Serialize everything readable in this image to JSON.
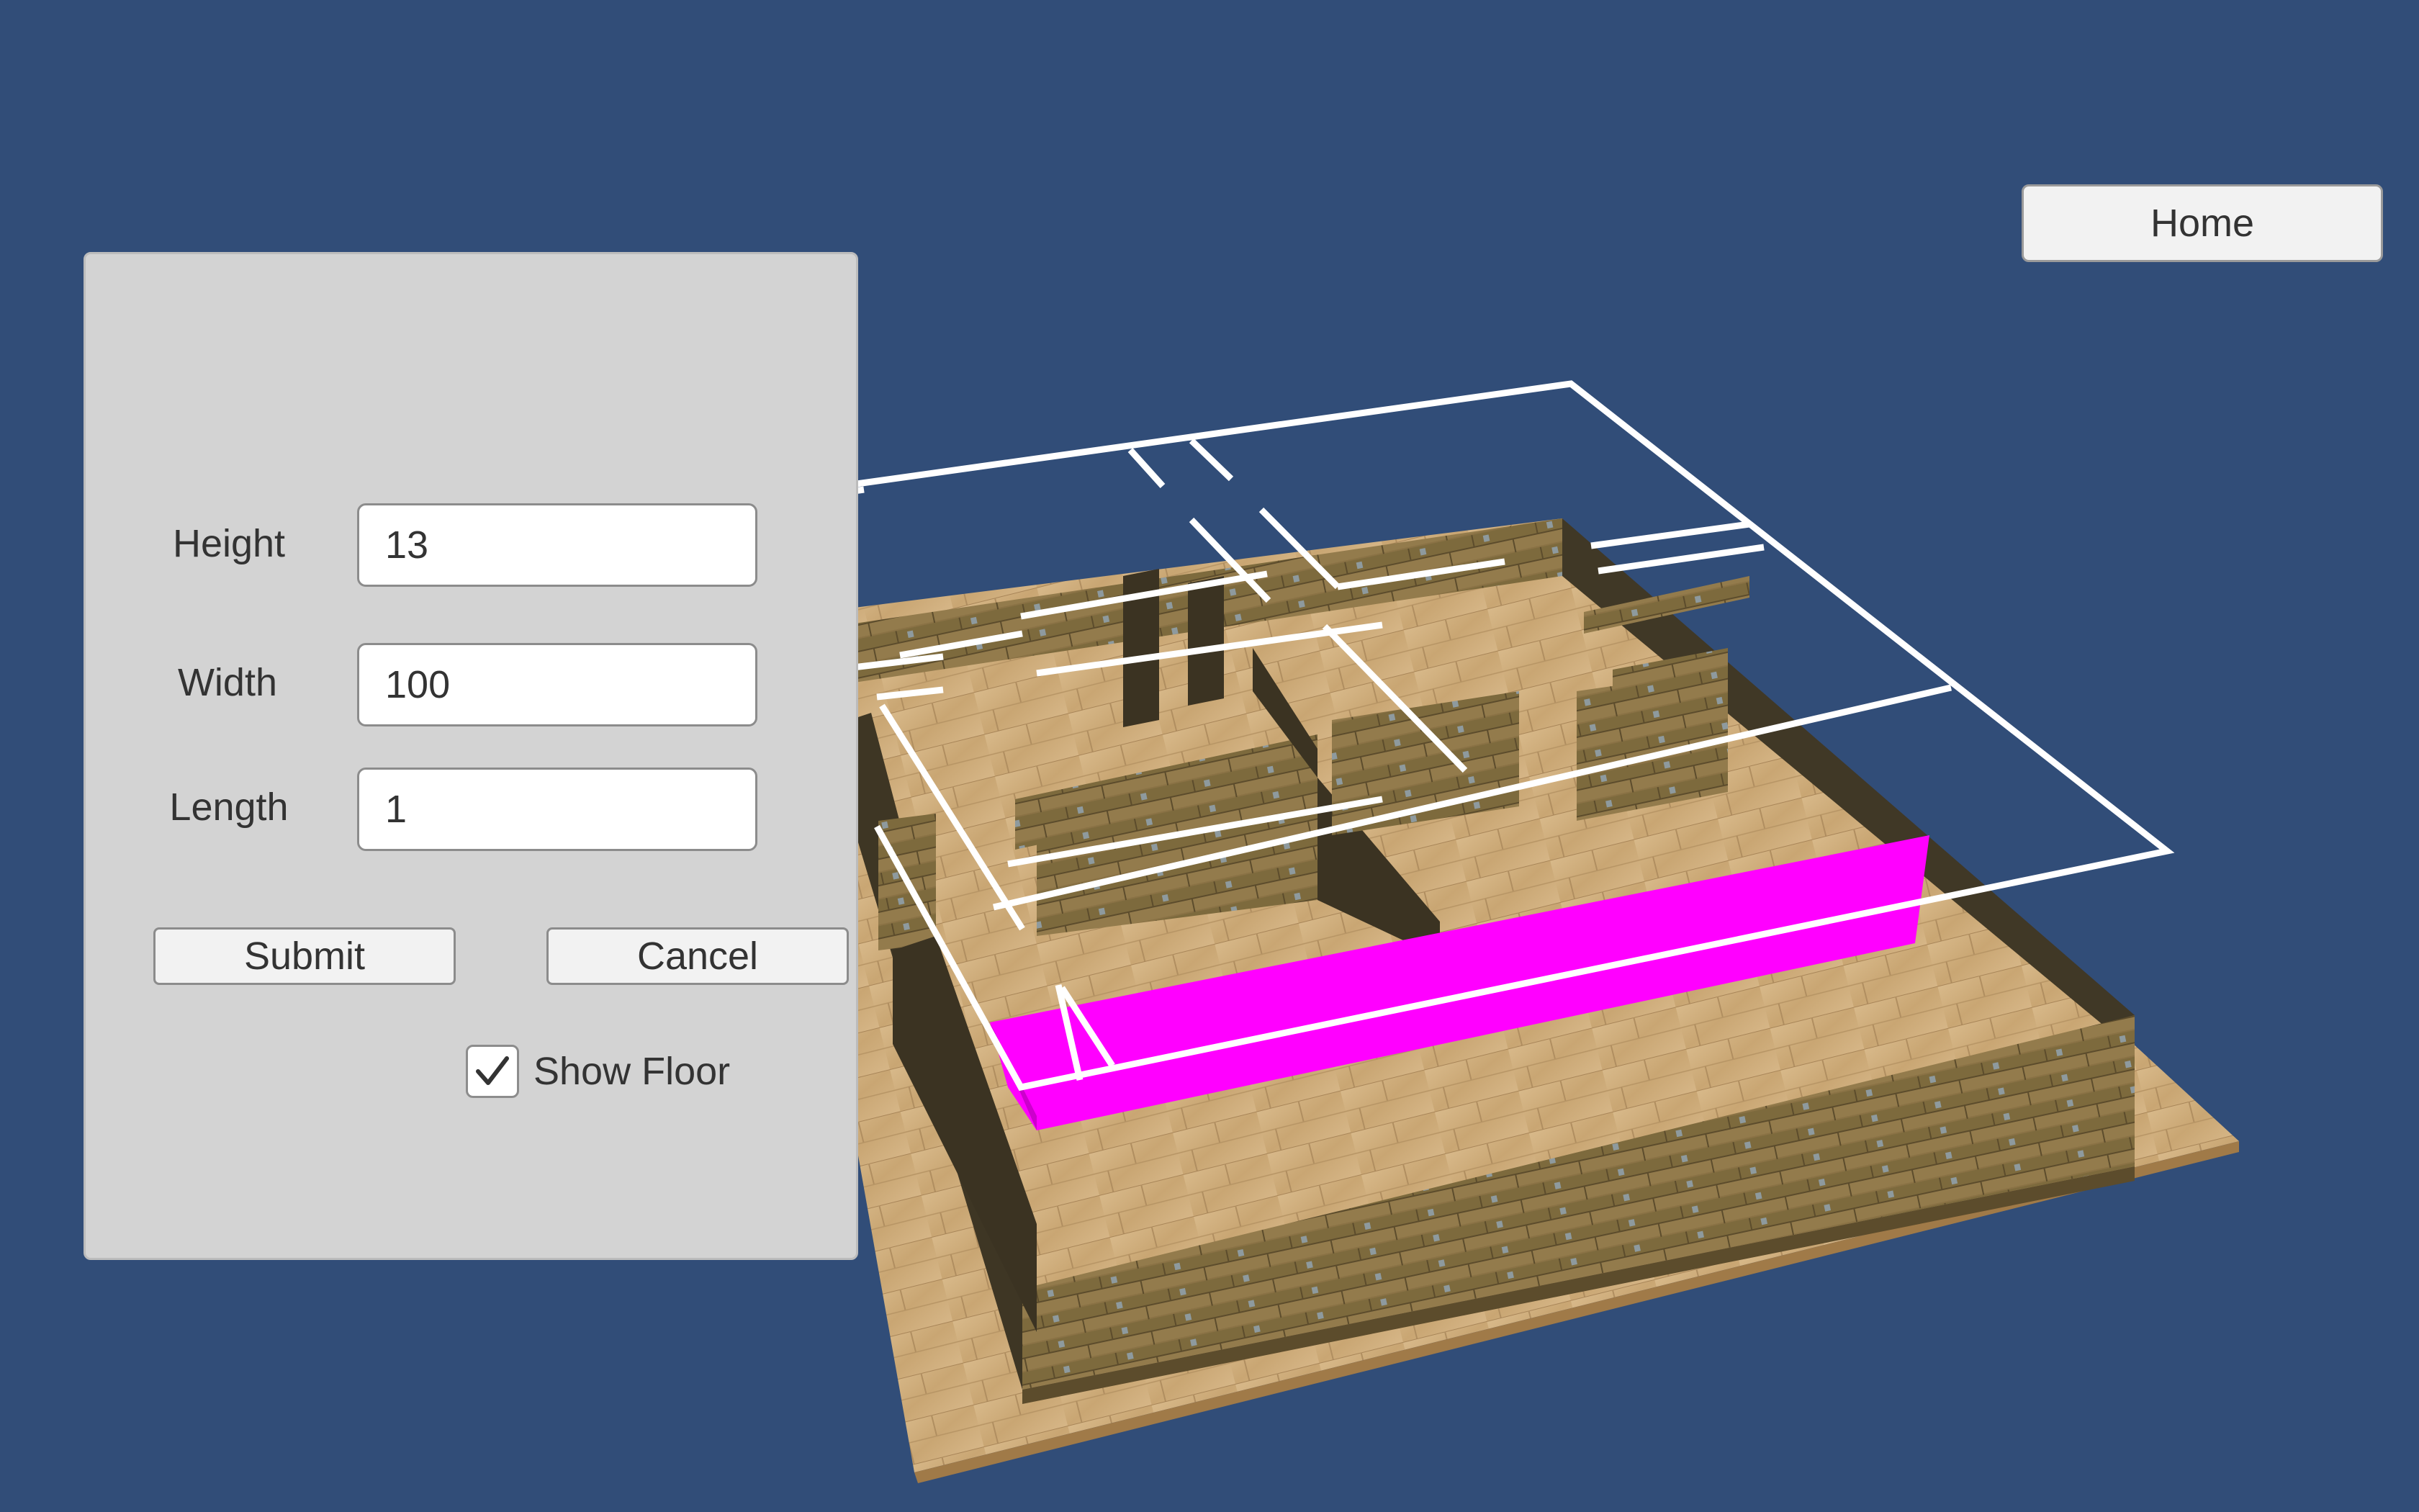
{
  "scene": {
    "background_color": "#314d78",
    "highlight_color": "#ff00ff",
    "outline_color": "#ffffff"
  },
  "header": {
    "home_label": "Home"
  },
  "dimensions_panel": {
    "height_label": "Height",
    "height_value": "13",
    "width_label": "Width",
    "width_value": "100",
    "length_label": "Length",
    "length_value": "1",
    "submit_label": "Submit",
    "cancel_label": "Cancel",
    "show_floor_label": "Show Floor",
    "show_floor_checked": true
  }
}
